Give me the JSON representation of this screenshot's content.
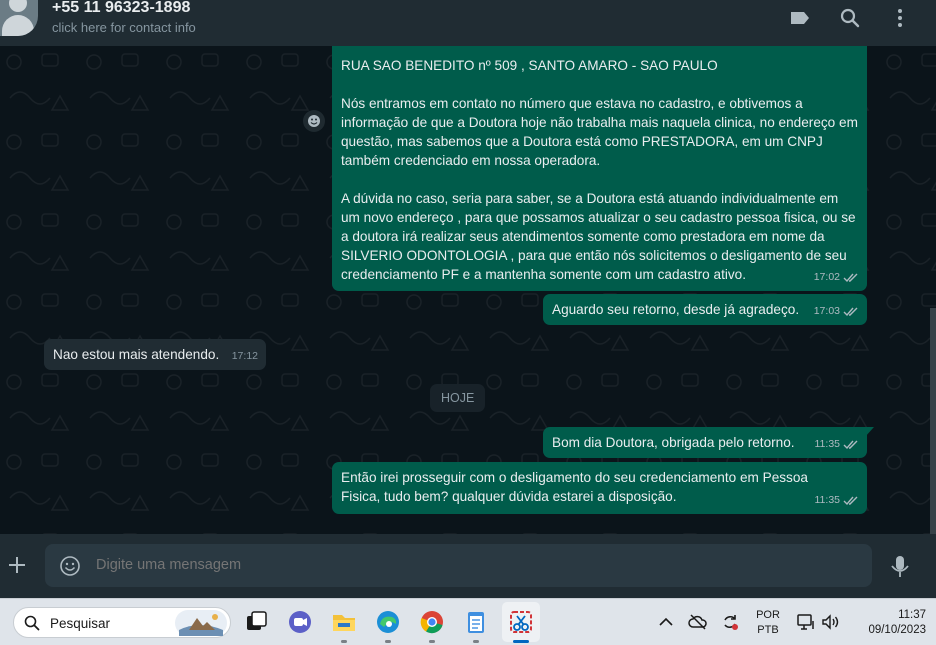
{
  "header": {
    "contact_name": "+55 11 96323-1898",
    "contact_subtitle": "click here for contact info",
    "icons": [
      "label-icon",
      "search-icon",
      "menu-icon"
    ]
  },
  "messages": [
    {
      "direction": "outgoing",
      "paragraphs": [
        "RUA SAO BENEDITO nº 509 , SANTO AMARO - SAO PAULO",
        "Nós entramos em contato no número que estava no cadastro, e obtivemos a informação de que a Doutora hoje não trabalha mais naquela clinica, no endereço em questão, mas sabemos que a Doutora está como PRESTADORA, em um CNPJ também credenciado em nossa operadora.",
        "A dúvida no caso, seria para saber, se a Doutora está atuando individualmente em um novo endereço , para que possamos atualizar o seu cadastro pessoa fisica, ou se a doutora irá realizar seus atendimentos somente como prestadora em nome da SILVERIO ODONTOLOGIA , para que então nós solicitemos o desligamento de seu credenciamento PF e a mantenha somente com um cadastro ativo."
      ],
      "time": "17:02"
    },
    {
      "direction": "outgoing",
      "text": "Aguardo seu retorno, desde já agradeço.",
      "time": "17:03"
    },
    {
      "direction": "incoming",
      "text": "Nao estou mais atendendo.",
      "time": "17:12"
    },
    {
      "direction": "outgoing",
      "text": "Bom dia Doutora, obrigada pelo retorno.",
      "time": "11:35"
    },
    {
      "direction": "outgoing",
      "text": "Então irei prosseguir com o desligamento do seu credenciamento em Pessoa Fisica, tudo bem? qualquer dúvida estarei a disposição.",
      "time": "11:35"
    }
  ],
  "date_divider": "HOJE",
  "composer": {
    "placeholder": "Digite uma mensagem"
  },
  "taskbar": {
    "search_label": "Pesquisar",
    "language_line1": "POR",
    "language_line2": "PTB",
    "time": "11:37",
    "date": "09/10/2023"
  },
  "colors": {
    "outgoing_bubble": "#005c4b",
    "incoming_bubble": "#202c33",
    "chat_background": "#0b141a",
    "header_background": "#202c33"
  }
}
